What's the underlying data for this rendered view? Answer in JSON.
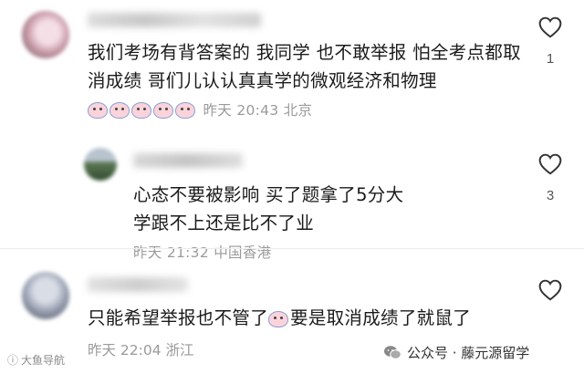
{
  "comments": [
    {
      "text": "我们考场有背答案的 我同学 也不敢举报 怕全考点都取消成绩 哥们儿认认真真学的微观经济和物理",
      "emoji_count": 5,
      "time": "昨天 20:43",
      "location": "北京",
      "likes": "1"
    },
    {
      "text": "心态不要被影响 买了题拿了5分大学跟不上还是比不了业",
      "time": "昨天 21:32",
      "location": "中国香港",
      "likes": "3"
    },
    {
      "text_before": "只能希望举报也不管了",
      "text_after": "要是取消成绩了就鼠了",
      "time": "昨天 22:04",
      "location": "浙江"
    }
  ],
  "watermark": {
    "left": "大鱼导航",
    "source": "公众号 · 藤元源留学"
  },
  "colors": {
    "meta": "#9a9a9a",
    "text": "#1a1a1a"
  }
}
